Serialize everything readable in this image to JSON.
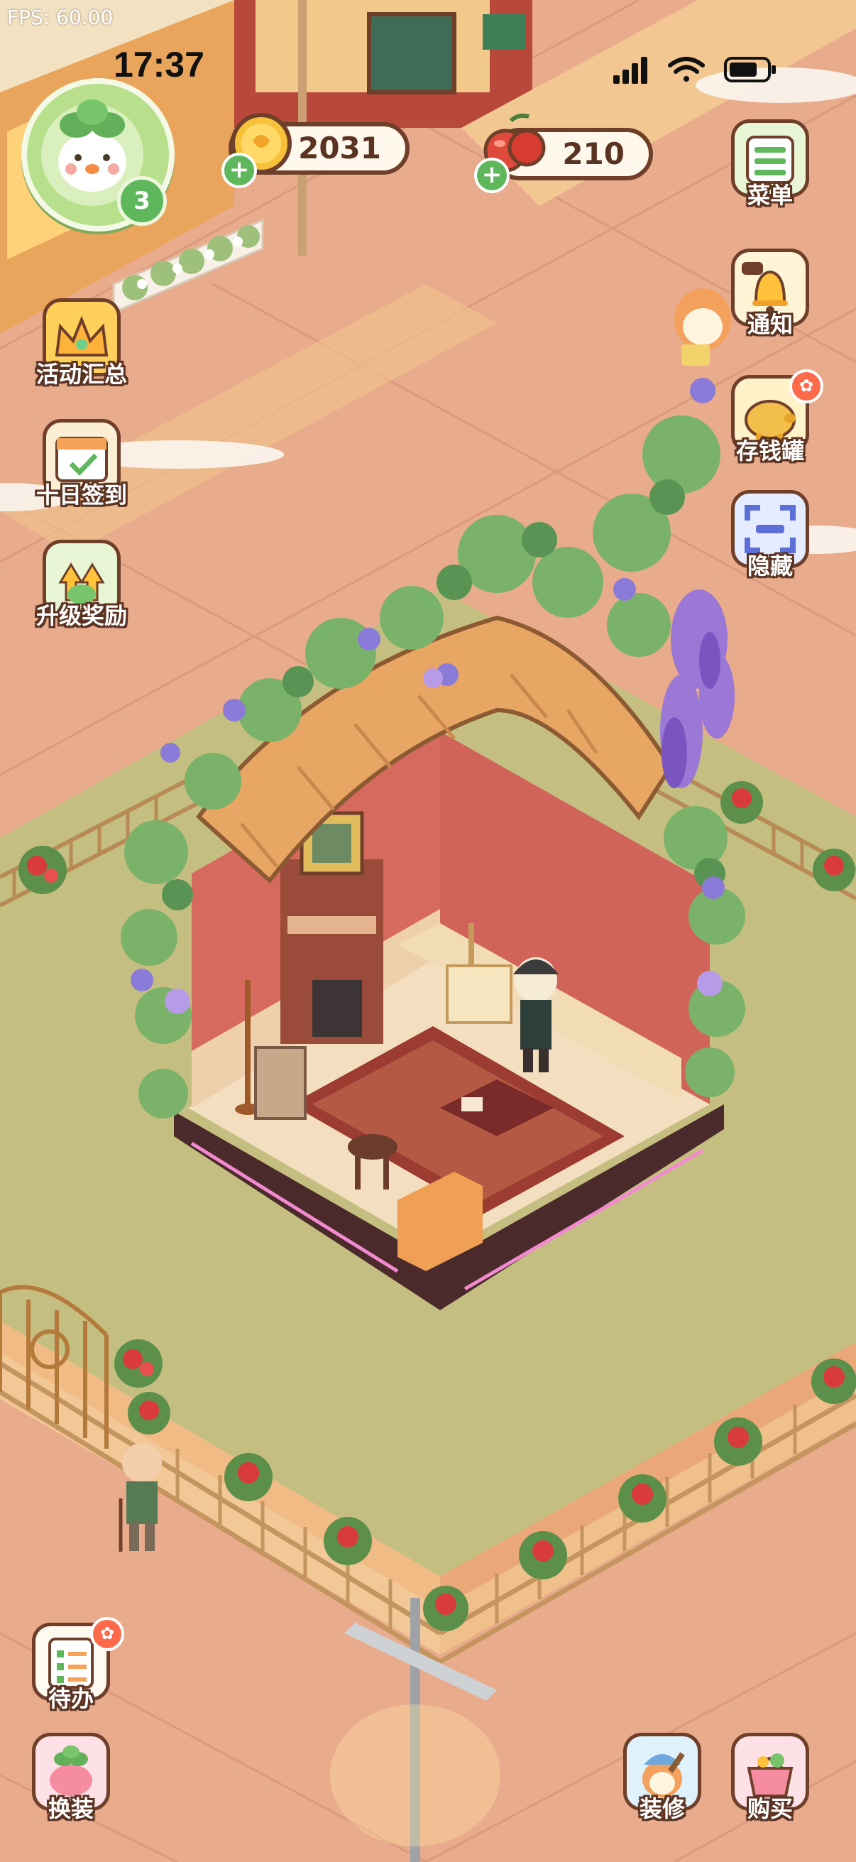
{
  "debug": {
    "fps": "FPS: 60.00"
  },
  "status_bar": {
    "time": "17:37"
  },
  "player": {
    "level": "3"
  },
  "currencies": {
    "coins": "2031",
    "fruit": "210"
  },
  "left_menu": {
    "events_label": "活动汇总",
    "checkin_label": "十日签到",
    "upgrade_label": "升级奖励",
    "todo_label": "待办",
    "dressup_label": "换装"
  },
  "right_menu": {
    "menu_label": "菜单",
    "notify_label": "通知",
    "piggybank_label": "存钱罐",
    "hide_label": "隐藏",
    "decorate_label": "装修",
    "shop_label": "购买"
  },
  "icons": {
    "coin": "coin-icon",
    "fruit": "cherry-fruit-icon",
    "signal": "cell-signal-icon",
    "wifi": "wifi-icon",
    "battery": "battery-icon"
  }
}
